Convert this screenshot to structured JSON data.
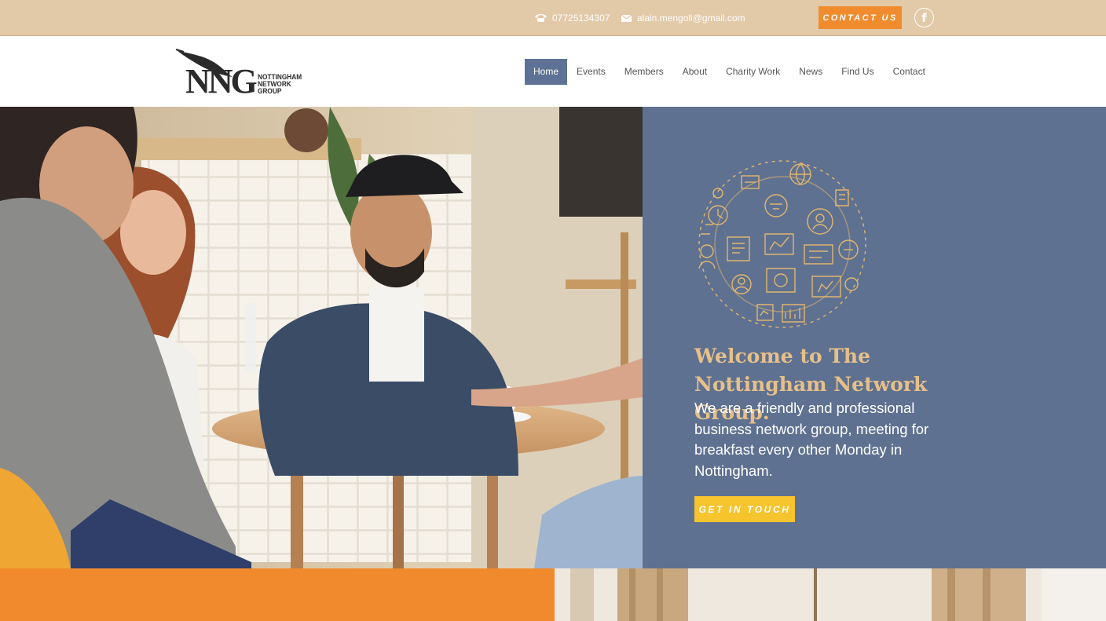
{
  "topbar": {
    "phone": "07725134307",
    "email": "alain.mengoli@gmail.com",
    "contact_button": "CONTACT US",
    "phone_icon": "phone-icon",
    "email_icon": "envelope-icon",
    "social_icon": "facebook-icon",
    "facebook_glyph": "f"
  },
  "logo": {
    "initials": "NNG",
    "line1": "NOTTINGHAM",
    "line2": "NETWORK",
    "line3": "GROUP"
  },
  "nav": {
    "items": [
      {
        "label": "Home",
        "active": true
      },
      {
        "label": "Events"
      },
      {
        "label": "Members"
      },
      {
        "label": "About"
      },
      {
        "label": "Charity Work"
      },
      {
        "label": "News"
      },
      {
        "label": "Find Us"
      },
      {
        "label": "Contact"
      }
    ]
  },
  "hero": {
    "heading": "Welcome to The Nottingham Network Group.",
    "intro": "We are a friendly and professional business network group, meeting for breakfast every other Monday in Nottingham.",
    "button": "GET IN TOUCH"
  },
  "colors": {
    "topbar_bg": "#e2c9a8",
    "accent_orange": "#f18c2e",
    "nav_active": "#5e7295",
    "hero_panel": "#5f7191",
    "heading_gold": "#e6c089",
    "button_yellow": "#f6c42d"
  }
}
